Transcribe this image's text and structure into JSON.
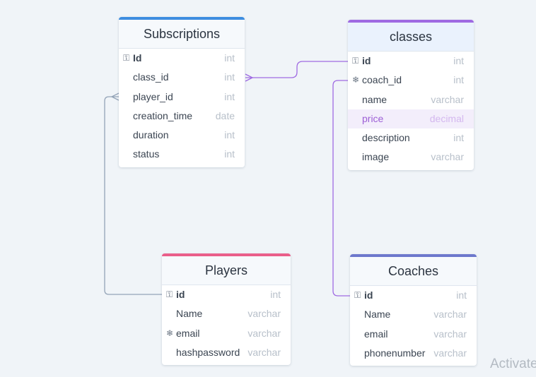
{
  "colors": {
    "subscriptions_header": "#3d8de0",
    "classes_header": "#9f6ae2",
    "players_header": "#ea5f8a",
    "coaches_header": "#6d78cc",
    "connector_purple": "#9f6ae2",
    "connector_gray": "#93a3b7"
  },
  "icons": {
    "primary_key": "key-icon",
    "foreign_key": "snowflake-icon"
  },
  "tables": {
    "subscriptions": {
      "title": "Subscriptions",
      "fields": [
        {
          "name": "Id",
          "type": "int"
        },
        {
          "name": "class_id",
          "type": "int"
        },
        {
          "name": "player_id",
          "type": "int"
        },
        {
          "name": "creation_time",
          "type": "date"
        },
        {
          "name": "duration",
          "type": "int"
        },
        {
          "name": "status",
          "type": "int"
        }
      ]
    },
    "classes": {
      "title": "classes",
      "fields": [
        {
          "name": "id",
          "type": "int"
        },
        {
          "name": "coach_id",
          "type": "int"
        },
        {
          "name": "name",
          "type": "varchar"
        },
        {
          "name": "price",
          "type": "decimal"
        },
        {
          "name": "description",
          "type": "int"
        },
        {
          "name": "image",
          "type": "varchar"
        }
      ]
    },
    "players": {
      "title": "Players",
      "fields": [
        {
          "name": "id",
          "type": "int"
        },
        {
          "name": "Name",
          "type": "varchar"
        },
        {
          "name": "email",
          "type": "varchar"
        },
        {
          "name": "hashpassword",
          "type": "varchar"
        }
      ]
    },
    "coaches": {
      "title": "Coaches",
      "fields": [
        {
          "name": "id",
          "type": "int"
        },
        {
          "name": "Name",
          "type": "varchar"
        },
        {
          "name": "email",
          "type": "varchar"
        },
        {
          "name": "phonenumber",
          "type": "varchar"
        }
      ]
    }
  },
  "watermark": "Activate"
}
